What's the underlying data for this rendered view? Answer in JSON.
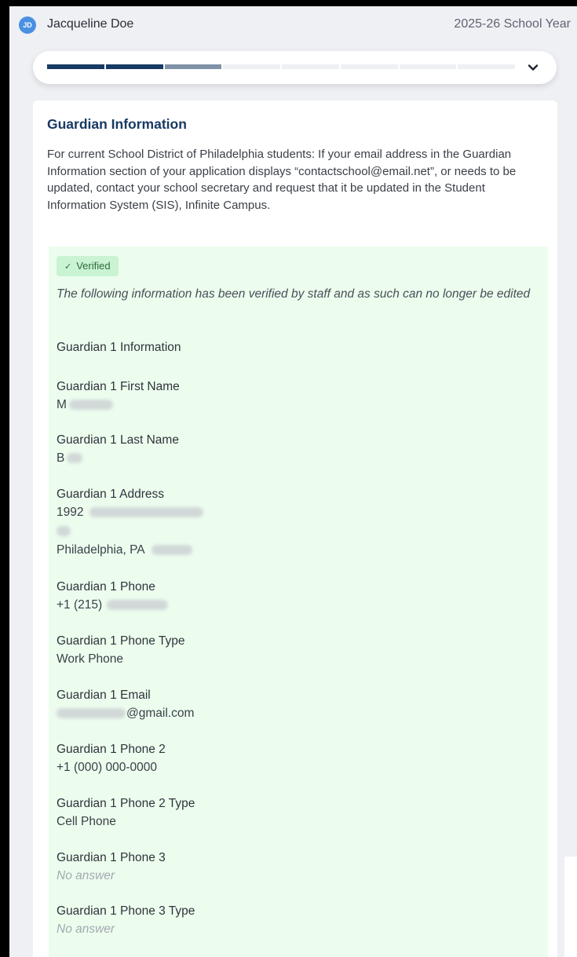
{
  "header": {
    "avatar_initials": "JD",
    "user_name": "Jacqueline Doe",
    "school_year": "2025-26 School Year"
  },
  "progress": {
    "total_steps": 8,
    "completed_steps": 2,
    "current_step": 3,
    "colors": {
      "done": "#163a64",
      "current": "#8092a8",
      "pending": "#eef0f3"
    }
  },
  "section": {
    "title": "Guardian Information",
    "description": "For current School District of Philadelphia students: If your email address in the Guardian Information section of your application displays “contactschool@email.net”, or needs to be updated, contact your school secretary and request that it be updated in the Student Information System (SIS), Infinite Campus."
  },
  "verified": {
    "badge_label": "Verified",
    "note": "The following information has been verified by staff and as such can no longer be edited",
    "badge_color": "#c9f3d2",
    "panel_color": "#ecfdee"
  },
  "guardian": {
    "heading": "Guardian 1 Information",
    "first_name": {
      "label": "Guardian 1 First Name",
      "value": "M"
    },
    "last_name": {
      "label": "Guardian 1 Last Name",
      "value": "B"
    },
    "address": {
      "label": "Guardian 1 Address",
      "line1": "1992",
      "line2": "",
      "line3": "Philadelphia, PA"
    },
    "phone": {
      "label": "Guardian 1 Phone",
      "value": "+1 (215)"
    },
    "phone_type": {
      "label": "Guardian 1 Phone Type",
      "value": "Work Phone"
    },
    "email": {
      "label": "Guardian 1 Email",
      "value": "@gmail.com"
    },
    "phone2": {
      "label": "Guardian 1 Phone 2",
      "value": "+1 (000) 000-0000"
    },
    "phone2_type": {
      "label": "Guardian 1 Phone 2 Type",
      "value": "Cell Phone"
    },
    "phone3": {
      "label": "Guardian 1 Phone 3",
      "value": "No answer"
    },
    "phone3_type": {
      "label": "Guardian 1 Phone 3 Type",
      "value": "No answer"
    }
  }
}
